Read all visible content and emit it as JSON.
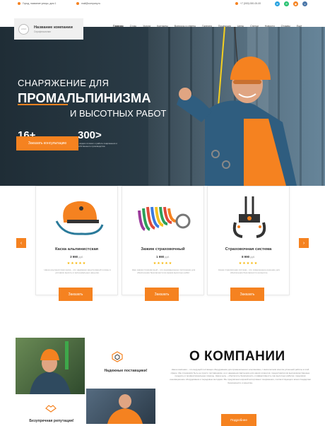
{
  "topbar": {
    "address": "Город, название улицы, дом 1",
    "email": "mail@company.ru",
    "phone": "+7 (000) 000-00-00"
  },
  "header": {
    "company_name": "Название компании",
    "company_sub": "Спрофессионал",
    "logo_text": "LOGO",
    "nav": [
      "Главная",
      "О нас",
      "Услуги",
      "Контакты",
      "Вопросы и ответы",
      "Галерея",
      "Продукция",
      "Цены",
      "Статьи",
      "Новости",
      "Отзывы",
      "Ещё"
    ]
  },
  "hero": {
    "line1": "СНАРЯЖЕНИЕ ДЛЯ",
    "line2": "ПРОМАЛЬПИНИЗМА",
    "line3": "И ВЫСОТНЫХ РАБОТ",
    "stats": [
      {
        "num": "16+",
        "desc": "...лет в сфере производства высотной снаряжения"
      },
      {
        "num": "300>",
        "desc": "...видов готового к работе снаряжения и собственного производства"
      }
    ],
    "button": "Заказать консультацию"
  },
  "products": [
    {
      "title": "Каска альпинистская",
      "price": "3 990",
      "currency": "руб.",
      "stars": "★★★★★",
      "desc": "Наша альпинистская каска – это надёжная защита вашей головы в условиях высоты и экстремальных нагрузок.",
      "button": "Заказать"
    },
    {
      "title": "Зажим страховочный",
      "price": "1 990",
      "currency": "руб.",
      "stars": "★★★★★",
      "desc": "Наш зажим страховочный – это инновационное построение для обеспечения безопасности во время высотных работ.",
      "button": "Заказать"
    },
    {
      "title": "Страховочная система",
      "price": "8 990",
      "currency": "руб.",
      "stars": "★★★★★",
      "desc": "Наша страховочная система – это совершенное решение для обеспечения безопасности на высоте.",
      "button": "Заказать"
    }
  ],
  "about": {
    "feature1": "Надежные поставщики!",
    "feature2": "Безупречная репутация!",
    "title": "О КОМПАНИИ",
    "text": "Наша компания – это ведущий поставщик оборудования для промышленного альпинизма, с многолетним опытом успешной работы в этой сфере. Мы стремимся быть не просто поставщиком, но и надежным партнером для наших клиентов, предоставляя им высококачественные продукты и профессиональную помощь. Наша цель – обеспечить безопасность и эффективность при высотных работах, предлагая инновационное оборудование и передовые методики. Мы предлагаем широкий ассортимент снаряжения, соответствующего всем стандартам безопасности и качества.",
    "button": "Подробнее"
  },
  "colors": {
    "accent": "#f58220",
    "dark": "#1f2d36",
    "stars": "#f7b500"
  }
}
